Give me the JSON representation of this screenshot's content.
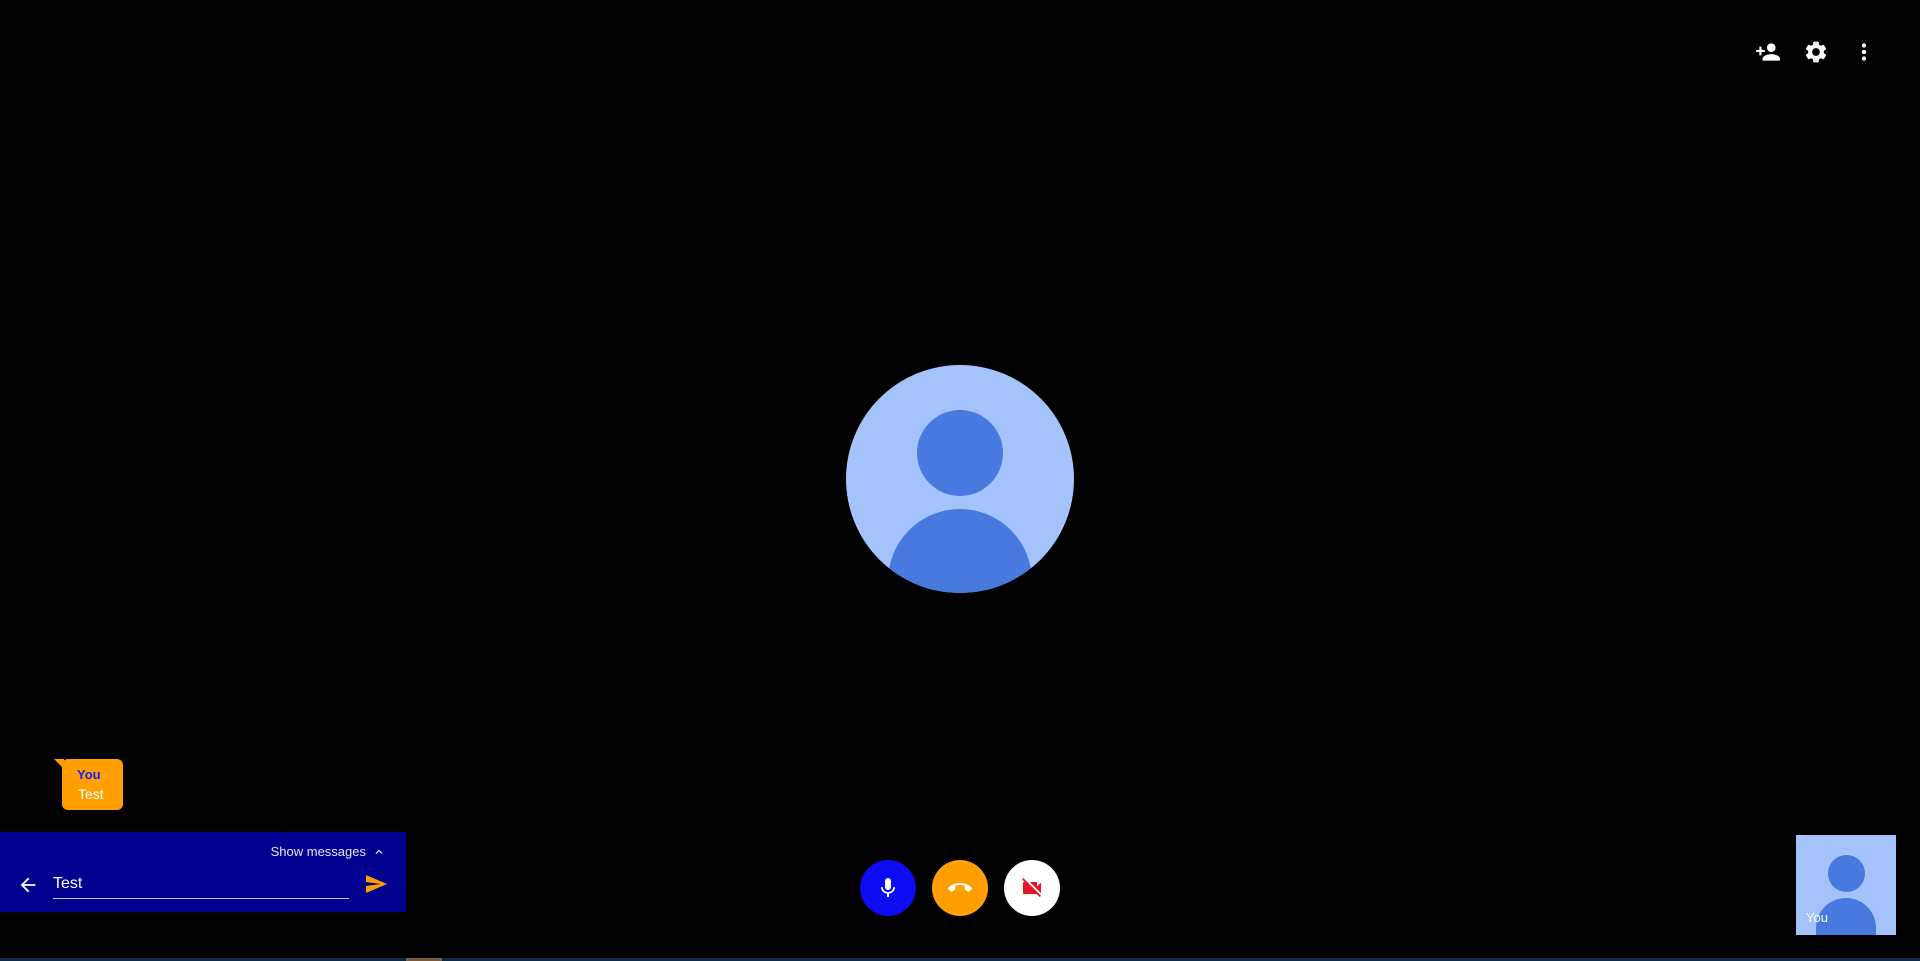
{
  "toolbar": {
    "icons": [
      "add-person-icon",
      "settings-icon",
      "more-vertical-icon"
    ]
  },
  "main_participant": {
    "avatar": "person-icon"
  },
  "chat": {
    "bubble": {
      "sender": "You",
      "message": "Test"
    },
    "show_messages_label": "Show messages",
    "input_value": "Test",
    "icons": [
      "arrow-back-icon",
      "send-icon",
      "chevron-up-icon"
    ]
  },
  "controls": {
    "icons": [
      "mic-icon",
      "call-end-icon",
      "videocam-off-icon"
    ]
  },
  "self_view": {
    "label": "You"
  },
  "colors": {
    "background": "#000000",
    "avatar_bg": "#a5c3fb",
    "avatar_fg": "#4779de",
    "accent_orange": "#ffa000",
    "chat_panel": "#01018f",
    "mic_button": "#0c0cf2",
    "camera_off_icon": "#e8132b"
  }
}
